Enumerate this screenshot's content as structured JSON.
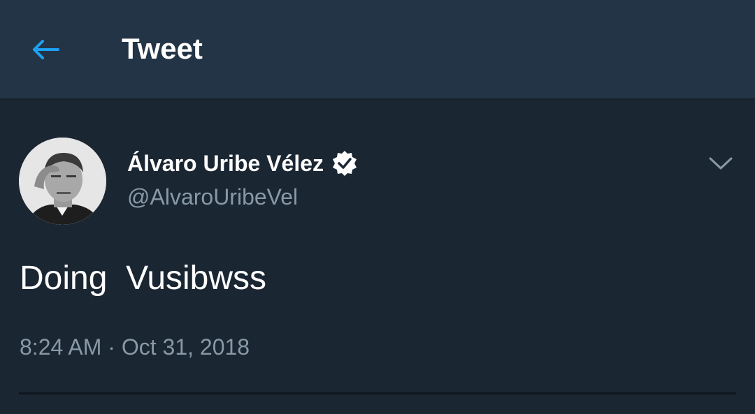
{
  "header": {
    "back_icon": "arrow-left-icon",
    "title": "Tweet",
    "accent_color": "#1da1f2"
  },
  "tweet": {
    "author": {
      "name": "Álvaro Uribe Vélez",
      "handle": "@AlvaroUribeVel",
      "verified": true,
      "verified_icon": "verified-badge-icon",
      "avatar": "grayscale-portrait-avatar"
    },
    "menu_icon": "chevron-down-icon",
    "text": "Doing  Vusibwss",
    "timestamp": "8:24 AM · Oct 31, 2018"
  },
  "colors": {
    "background": "#1b2633",
    "header_background": "#243447",
    "primary_text": "#ffffff",
    "secondary_text": "#8899a6"
  }
}
